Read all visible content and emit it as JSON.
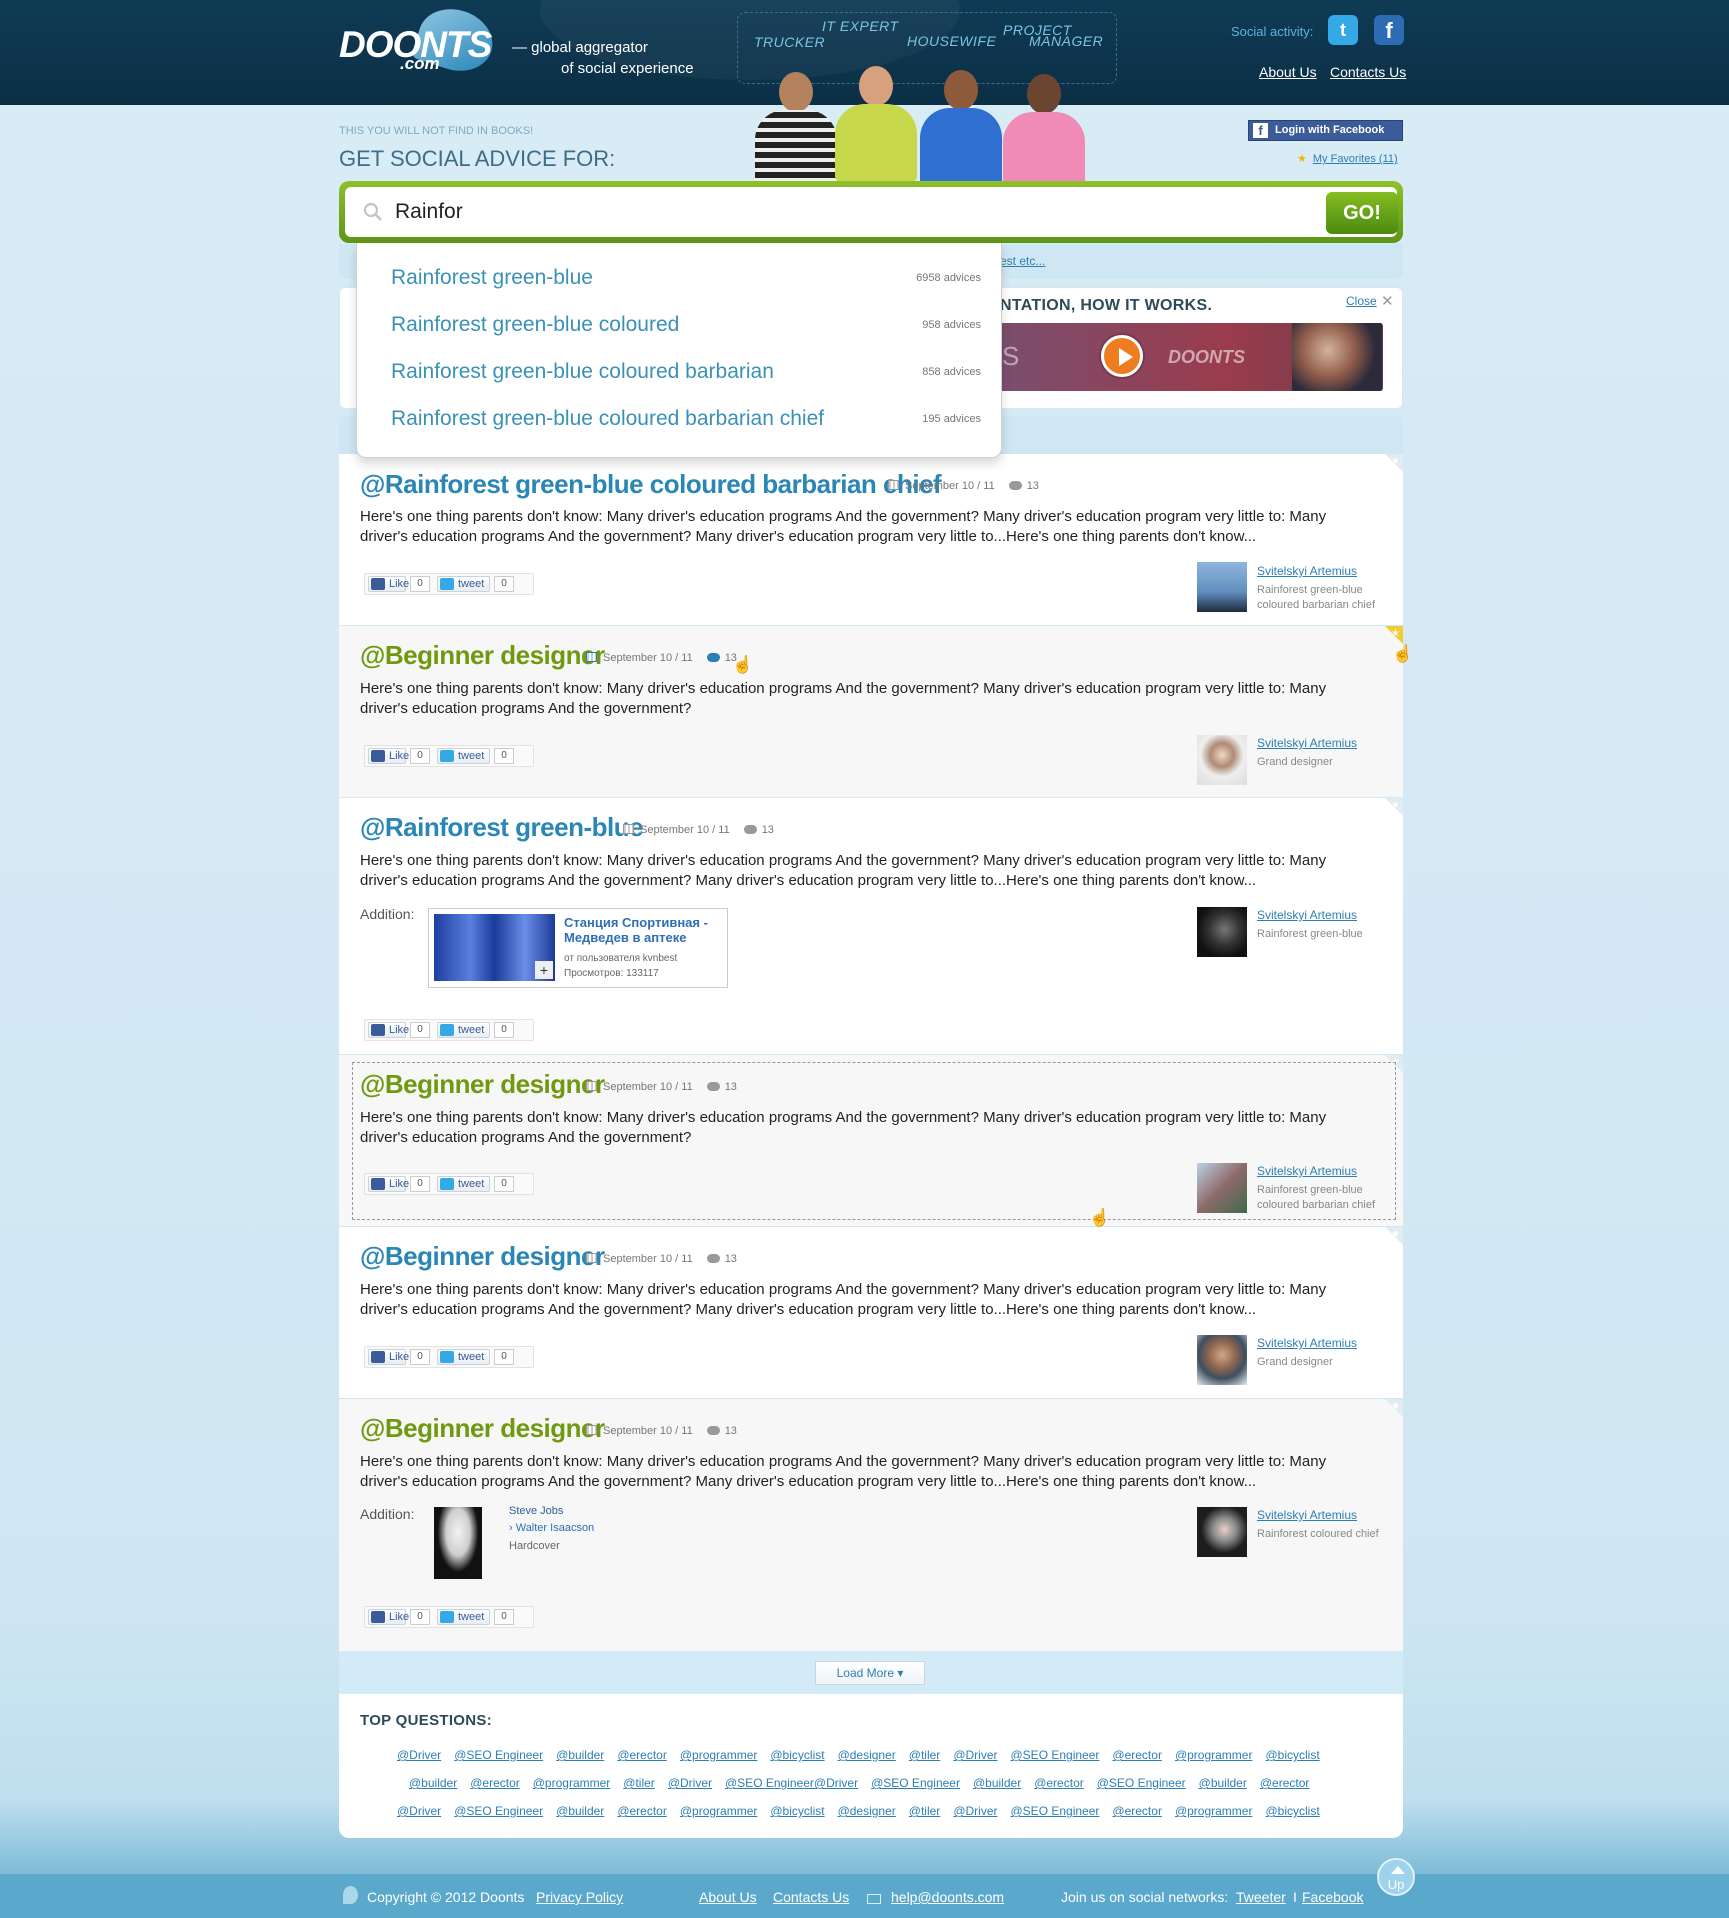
{
  "header": {
    "logo": "DOONTS",
    "logo_sub": ".com",
    "tagline_line1": "— global aggregator",
    "tagline_line2": "of social experience",
    "roles": [
      "TRUCKER",
      "IT EXPERT",
      "HOUSEWIFE",
      "PROJECT",
      "MANAGER"
    ],
    "social_label": "Social activity:",
    "twitter_glyph": "t",
    "facebook_glyph": "f",
    "nav": {
      "about": "About Us",
      "contacts": "Contacts Us"
    }
  },
  "hero": {
    "caption": "THIS YOU WILL NOT FIND IN BOOKS!",
    "title": "GET SOCIAL ADVICE FOR:",
    "login_facebook": "Login with Facebook",
    "favorites": "My Favorites (11)"
  },
  "search": {
    "value": "Rainfor",
    "go_label": "GO!",
    "hint_partial": "est etc..."
  },
  "autocomplete": [
    {
      "label": "Rainforest green-blue",
      "count": "6958 advices"
    },
    {
      "label": "Rainforest green-blue coloured",
      "count": "958 advices"
    },
    {
      "label": "Rainforest green-blue coloured barbarian",
      "count": "858 advices"
    },
    {
      "label": "Rainforest green-blue coloured barbarian chief",
      "count": "195 advices"
    }
  ],
  "promo": {
    "title": "NTATION, HOW IT WORKS.",
    "close": "Close",
    "close_x": "✕",
    "video_left": "S",
    "video_brand": "DOONTS"
  },
  "posts": [
    {
      "title": "@Rainforest green-blue coloured barbarian chief",
      "date": "September 10 / 11",
      "comments": "13",
      "text": "Here's one thing parents don't know: Many driver's education programs  And the government? Many driver's education program very little to: Many driver's education programs And the government? Many driver's education program very little to...Here's one thing parents don't know...",
      "like": "Like",
      "like_count": "0",
      "tweet": "tweet",
      "tweet_count": "0",
      "author": "Svitelskyi Artemius",
      "role": "Rainforest green-blue coloured barbarian chief"
    },
    {
      "title": "@Beginner designer",
      "date": "September 10 / 11",
      "comments": "13",
      "text": "Here's one thing parents don't know: Many driver's education programs  And the government? Many driver's education program very little to: Many driver's education programs And the government?",
      "like": "Like",
      "like_count": "0",
      "tweet": "tweet",
      "tweet_count": "0",
      "author": "Svitelskyi Artemius",
      "role": "Grand designer"
    },
    {
      "title": "@Rainforest green-blue",
      "date": "September 10 / 11",
      "comments": "13",
      "text": "Here's one thing parents don't know: Many driver's education programs  And the government? Many driver's education program very little to: Many driver's education programs And the government? Many driver's education program very little to...Here's one thing parents don't know...",
      "addition_label": "Addition:",
      "video_title": "Станция Спортивная - Медведев в аптеке",
      "video_user": "от пользователя kvnbest",
      "video_views": "Просмотров: 133117",
      "video_plus": "+",
      "like": "Like",
      "like_count": "0",
      "tweet": "tweet",
      "tweet_count": "0",
      "author": "Svitelskyi Artemius",
      "role": "Rainforest green-blue"
    },
    {
      "title": "@Beginner designer",
      "date": "September 10 / 11",
      "comments": "13",
      "text": "Here's one thing parents don't know: Many driver's education programs  And the government? Many driver's education program very little to: Many driver's education programs And the government?",
      "like": "Like",
      "like_count": "0",
      "tweet": "tweet",
      "tweet_count": "0",
      "author": "Svitelskyi Artemius",
      "role": "Rainforest green-blue coloured barbarian chief"
    },
    {
      "title": "@Beginner designer",
      "date": "September 10 / 11",
      "comments": "13",
      "text": "Here's one thing parents don't know: Many driver's education programs  And the government? Many driver's education program very little to: Many driver's education programs And the government? Many driver's education program very little to...Here's one thing parents don't know...",
      "like": "Like",
      "like_count": "0",
      "tweet": "tweet",
      "tweet_count": "0",
      "author": "Svitelskyi Artemius",
      "role": "Grand designer"
    },
    {
      "title": "@Beginner designer",
      "date": "September 10 / 11",
      "comments": "13",
      "text": "Here's one thing parents don't know: Many driver's education programs  And the government? Many driver's education program very little to: Many driver's education programs And the government? Many driver's education program very little to...Here's one thing parents don't know...",
      "addition_label": "Addition:",
      "book_title": "Steve Jobs",
      "book_author": "› Walter Isaacson",
      "book_type": "Hardcover",
      "like": "Like",
      "like_count": "0",
      "tweet": "tweet",
      "tweet_count": "0",
      "author": "Svitelskyi Artemius",
      "role": "Rainforest coloured chief"
    }
  ],
  "load_more": "Load More ▾",
  "top_questions": {
    "title": "TOP QUESTIONS:",
    "row1": [
      "@Driver",
      "@SEO Engineer",
      "@builder",
      "@erector",
      "@programmer",
      "@bicyclist",
      "@designer",
      "@tiler",
      "@Driver",
      "@SEO Engineer",
      "@erector",
      "@programmer",
      "@bicyclist"
    ],
    "row2": [
      "@builder",
      "@erector",
      "@programmer",
      "@tiler",
      "@Driver",
      "@SEO Engineer@Driver",
      "@SEO Engineer",
      "@builder",
      "@erector",
      "@SEO Engineer",
      "@builder",
      "@erector"
    ],
    "row3": [
      "@Driver",
      "@SEO Engineer",
      "@builder",
      "@erector",
      "@programmer",
      "@bicyclist",
      "@designer",
      "@tiler",
      "@Driver",
      "@SEO Engineer",
      "@erector",
      "@programmer",
      "@bicyclist"
    ]
  },
  "footer": {
    "copyright": "Copyright © 2012 Doonts",
    "privacy": "Privacy Policy",
    "about": "About Us",
    "contacts": "Contacts Us",
    "email": "help@doonts.com",
    "join": "Join us on social networks:",
    "tweeter": "Tweeter",
    "separator": "I",
    "facebook": "Facebook",
    "up": "Up"
  },
  "colors": {
    "header_bg": "#0f3b55",
    "accent_blue": "#2a86b4",
    "accent_green": "#6f9a10",
    "go_green": "#5d9516",
    "footer_bg": "#5aa9cd"
  }
}
